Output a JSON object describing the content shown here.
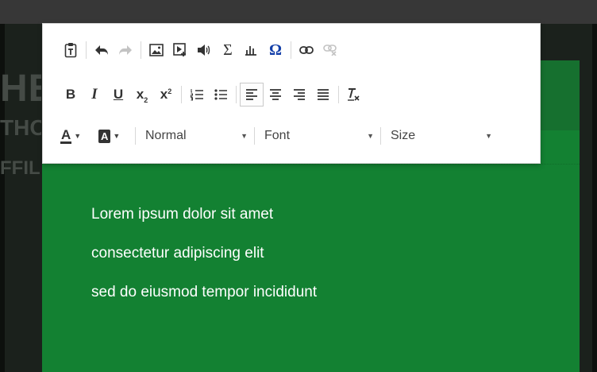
{
  "background_text": {
    "heading": "HE",
    "line2": "THO",
    "line3": "FFIL"
  },
  "content_lines": [
    "Lorem ipsum dolor sit amet",
    "consectetur adipiscing elit",
    "sed do eiusmod tempor incididunt"
  ],
  "toolbar": {
    "row2": {
      "bold": "B",
      "italic": "I",
      "underline": "U",
      "subscript": "x",
      "subscript_mark": "2",
      "superscript": "x",
      "superscript_mark": "2"
    },
    "symbols": {
      "sum": "Σ",
      "special_char": "Ω"
    },
    "font_color_letter": "A",
    "bg_color_letter": "A",
    "format_combo": {
      "value": "Normal"
    },
    "font_combo": {
      "value": "Font"
    },
    "size_combo": {
      "value": "Size"
    }
  },
  "colors": {
    "accent_green": "#138132",
    "toolbar_bg": "#ffffff",
    "omega_blue": "#123ea8"
  }
}
